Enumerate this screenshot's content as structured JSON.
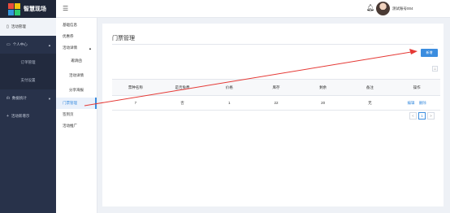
{
  "app": {
    "logo_text": "智慧现场"
  },
  "header": {
    "menu_icon": "menu-icon",
    "bell_icon": "bell-icon",
    "username": "测试账号004"
  },
  "sidebar": {
    "items": [
      {
        "label": "活动管理",
        "icon": "doc-icon",
        "active": true
      },
      {
        "label": "个人中心",
        "icon": "monitor-icon",
        "arrow": "▲"
      },
      {
        "label": "订单管理"
      },
      {
        "label": "支付设置"
      },
      {
        "label": "数据统计",
        "icon": "chart-icon",
        "arrow": "▼"
      },
      {
        "label": "活动新增示",
        "icon": "plus-icon"
      }
    ]
  },
  "submenu": {
    "items": [
      {
        "label": "基础信息"
      },
      {
        "label": "优惠券"
      },
      {
        "label": "活动详情",
        "arrow": "▲"
      },
      {
        "label": "邀请函"
      },
      {
        "label": "活动详情"
      },
      {
        "label": "分享海报"
      },
      {
        "label": "门票管理",
        "active": true
      },
      {
        "label": "签到页"
      },
      {
        "label": "活动推广"
      }
    ]
  },
  "main": {
    "title": "门票管理",
    "add_button": "新增",
    "tool_icon": "columns-icon",
    "columns": [
      "票种名称",
      "是否免费",
      "价格",
      "库存",
      "剩余",
      "备注",
      "操作"
    ],
    "rows": [
      {
        "cells": [
          "7",
          "否",
          "1",
          "22",
          "20",
          "无"
        ],
        "actions": [
          "编辑",
          "删除"
        ]
      }
    ],
    "pager": {
      "prev": "<",
      "current": "1",
      "next": ">"
    }
  },
  "colors": {
    "accent": "#3b8ddf",
    "sidebar_bg": "#28324a",
    "arrow": "#e53935"
  }
}
